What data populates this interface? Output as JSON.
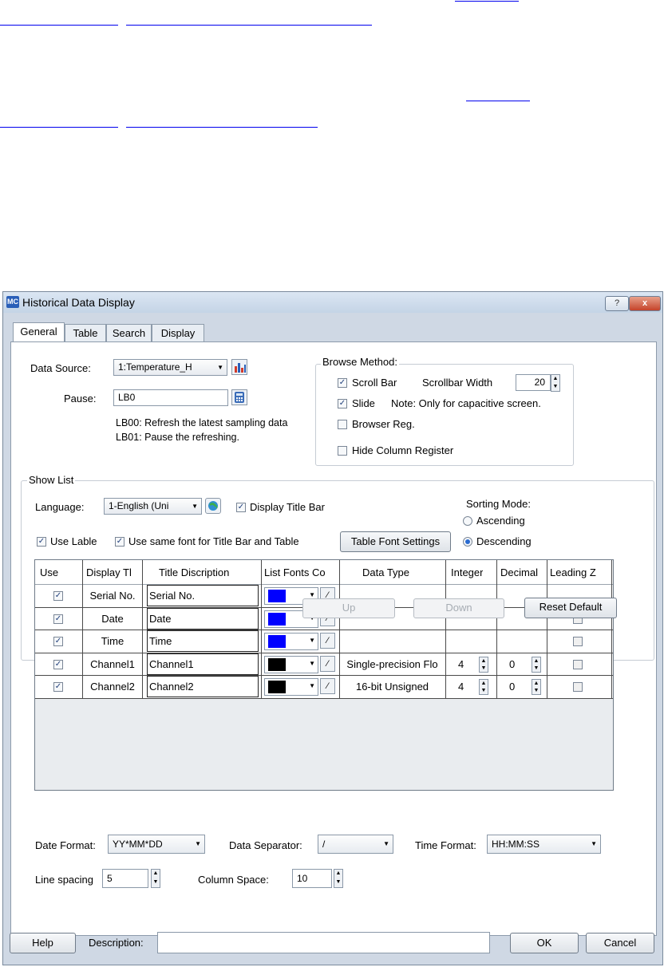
{
  "doc_links": {
    "line1_visible_text": "",
    "line2_visible_text": ""
  },
  "dialog": {
    "title": "Historical Data Display",
    "app_icon_text": "MC",
    "help_symbol": "?",
    "close_symbol": "x"
  },
  "tabs": [
    "General",
    "Table",
    "Search",
    "Display"
  ],
  "general": {
    "data_source_label": "Data Source:",
    "data_source_value": "1:Temperature_H",
    "pause_label": "Pause:",
    "pause_value": "LB0",
    "note_line1": "LB00: Refresh the latest sampling data",
    "note_line2": "LB01: Pause the refreshing."
  },
  "browse_method": {
    "title": "Browse Method:",
    "scroll_bar_label": "Scroll Bar",
    "scroll_bar_checked": true,
    "scrollbar_width_label": "Scrollbar Width",
    "scrollbar_width_value": "20",
    "slide_label": "Slide",
    "slide_checked": true,
    "slide_note": "Note: Only for capacitive screen.",
    "browser_reg_label": "Browser Reg.",
    "browser_reg_checked": false,
    "hide_column_register_label": "Hide Column Register",
    "hide_column_register_checked": false
  },
  "show_list": {
    "title": "Show List",
    "language_label": "Language:",
    "language_value": "1-English (Uni",
    "display_title_bar_label": "Display Title Bar",
    "use_lable_label": "Use Lable",
    "same_font_label": "Use same font for Title Bar and Table",
    "table_font_settings_button": "Table Font Settings",
    "sorting_mode_label": "Sorting Mode:",
    "ascending_label": "Ascending",
    "descending_label": "Descending",
    "sorting_selected": "Descending"
  },
  "table": {
    "columns": [
      "Use",
      "Display Tl",
      "Title Discription",
      "List Fonts Co",
      "Data Type",
      "Integer",
      "Decimal",
      "Leading Z"
    ],
    "rows": [
      {
        "use": true,
        "display": "Serial No.",
        "title": "Serial No.",
        "color": "#0000ff",
        "data_type": "",
        "integer": "",
        "decimal": "",
        "leading": null
      },
      {
        "use": true,
        "display": "Date",
        "title": "Date",
        "color": "#0000ff",
        "data_type": "",
        "integer": "",
        "decimal": "",
        "leading": false
      },
      {
        "use": true,
        "display": "Time",
        "title": "Time",
        "color": "#0000ff",
        "data_type": "",
        "integer": "",
        "decimal": "",
        "leading": false
      },
      {
        "use": true,
        "display": "Channel1",
        "title": "Channel1",
        "color": "#000000",
        "data_type": "Single-precision Flo",
        "integer": "4",
        "decimal": "0",
        "leading": false
      },
      {
        "use": true,
        "display": "Channel2",
        "title": "Channel2",
        "color": "#000000",
        "data_type": "16-bit Unsigned",
        "integer": "4",
        "decimal": "0",
        "leading": false
      }
    ]
  },
  "list_buttons": {
    "up": "Up",
    "down": "Down",
    "reset_default": "Reset Default"
  },
  "formats": {
    "date_format_label": "Date Format:",
    "date_format_value": "YY*MM*DD",
    "data_separator_label": "Data Separator:",
    "data_separator_value": "/",
    "time_format_label": "Time Format:",
    "time_format_value": "HH:MM:SS",
    "line_spacing_label": "Line spacing",
    "line_spacing_value": "5",
    "column_space_label": "Column Space:",
    "column_space_value": "10"
  },
  "footer": {
    "help_button": "Help",
    "description_label": "Description:",
    "description_value": "",
    "ok_button": "OK",
    "cancel_button": "Cancel"
  }
}
